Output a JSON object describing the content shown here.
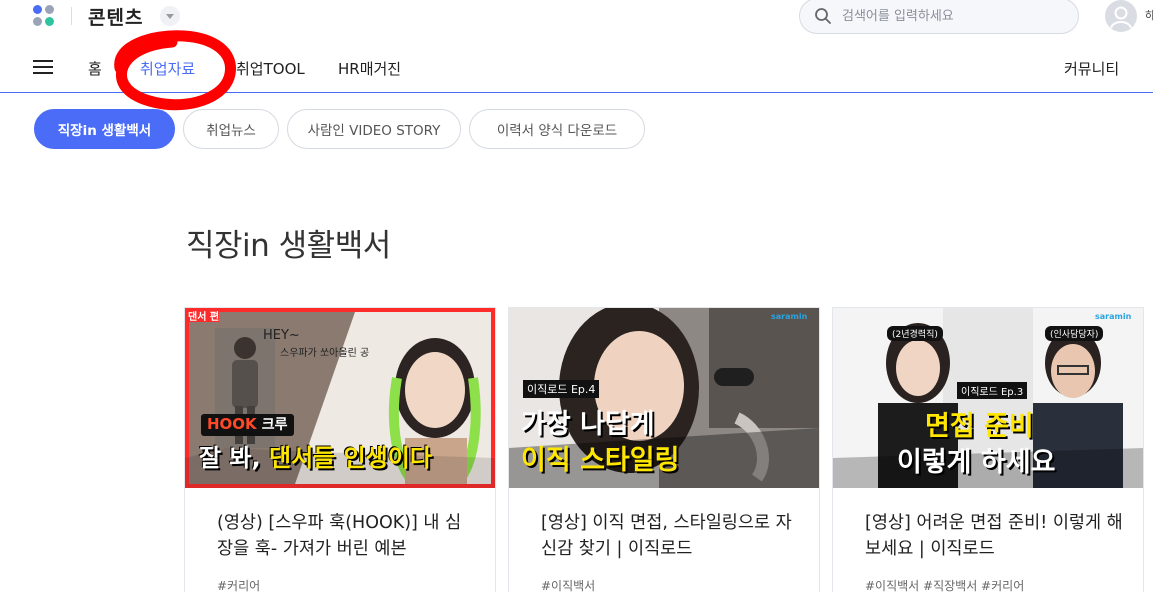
{
  "header": {
    "brand": "콘텐츠",
    "search_placeholder": "검색어를 입력하세요",
    "user_initial": "하"
  },
  "nav": {
    "items": [
      {
        "label": "홈",
        "active": false
      },
      {
        "label": "취업자료",
        "active": true
      },
      {
        "label": "취업TOOL",
        "active": false
      },
      {
        "label": "HR매거진",
        "active": false
      }
    ],
    "community": "커뮤니티"
  },
  "chips": [
    {
      "label": "직장in 생활백서",
      "active": true
    },
    {
      "label": "취업뉴스",
      "active": false
    },
    {
      "label": "사람인 VIDEO STORY",
      "active": false
    },
    {
      "label": "이력서 양식 다운로드",
      "active": false
    }
  ],
  "section": {
    "title": "직장in 생활백서"
  },
  "cards": [
    {
      "title": "(영상) [스우파 훅(HOOK)] 내 심장을 훅- 가져가 버린 예본",
      "tags": "#커리어",
      "thumb": {
        "badge": "댄서 편",
        "hey": "HEY~",
        "sub": "스우파가 쏘아올린 공",
        "hook": "HOOK",
        "crew": "크루",
        "line_a": "잘 봐, ",
        "line_b": "댄서들 인생이다"
      }
    },
    {
      "title": "[영상] 이직 면접, 스타일링으로 자신감 찾기 | 이직로드",
      "tags": "#이직백서",
      "thumb": {
        "logo": "saramin",
        "ep": "이직로드 Ep.4",
        "line1": "가장 나답게",
        "line2": "이직 스타일링"
      }
    },
    {
      "title": "[영상] 어려운 면접 준비! 이렇게 해보세요 | 이직로드",
      "tags": "#이직백서 #직장백서 #커리어",
      "thumb": {
        "logo": "saramin",
        "left_label": "(2년경력직)",
        "right_label": "(인사담당자)",
        "ep": "이직로드 Ep.3",
        "line1": "면접 준비",
        "line2": "이렇게 하세요"
      }
    }
  ],
  "colors": {
    "accent": "#4a6cf7",
    "annotation": "#ff0000",
    "highlight_yellow": "#ffe600"
  }
}
